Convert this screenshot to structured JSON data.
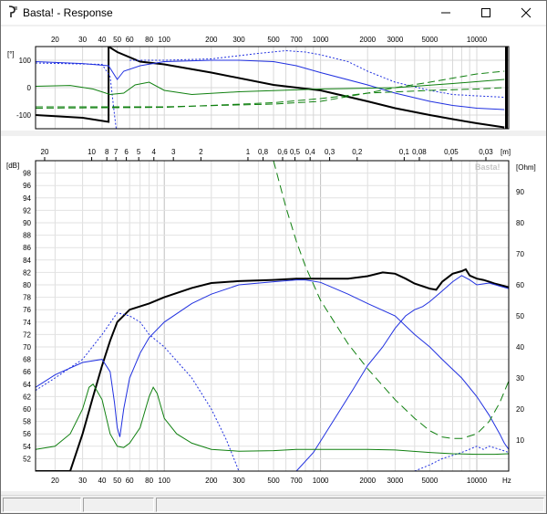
{
  "window": {
    "title": "Basta! - Response",
    "icon": "basta-app-icon",
    "controls": [
      "minimize-icon",
      "maximize-icon",
      "close-icon"
    ]
  },
  "phase_chart": {
    "y_unit": "[°]",
    "y_ticks": [
      "100",
      "0",
      "-100"
    ],
    "x_ticks": [
      "20",
      "30",
      "40",
      "50",
      "60",
      "80",
      "100",
      "200",
      "300",
      "500",
      "700",
      "1000",
      "2000",
      "3000",
      "5000",
      "10000"
    ]
  },
  "main_chart": {
    "watermark": "Basta!",
    "left_unit": "[dB]",
    "right_unit": "[Ohm]",
    "top_unit": "[m]",
    "bottom_unit": "Hz",
    "spl_ticks": [
      "98",
      "96",
      "94",
      "92",
      "90",
      "88",
      "86",
      "84",
      "82",
      "80",
      "78",
      "76",
      "74",
      "72",
      "70",
      "68",
      "66",
      "64",
      "62",
      "60",
      "58",
      "56",
      "54",
      "52"
    ],
    "ohm_ticks": [
      "90",
      "80",
      "70",
      "60",
      "50",
      "40",
      "30",
      "20",
      "10"
    ],
    "wavelength_ticks": [
      "30",
      "20",
      "10",
      "8",
      "7",
      "6",
      "5",
      "4",
      "3",
      "2",
      "1",
      "0,8",
      "0,6",
      "0,5",
      "0,4",
      "0,3",
      "0,2",
      "0,1",
      "0,08",
      "0,05",
      "0,03"
    ],
    "freq_ticks": [
      "20",
      "30",
      "40",
      "50",
      "60",
      "80",
      "100",
      "200",
      "300",
      "500",
      "700",
      "1000",
      "2000",
      "3000",
      "5000",
      "10000"
    ]
  },
  "chart_data": {
    "type": "line",
    "x_scale": "log",
    "xlim": [
      15,
      16000
    ],
    "ylim": [
      50,
      100
    ],
    "y2lim": [
      0,
      100
    ],
    "xlabel": "Hz",
    "ylabel": "[dB]",
    "y2label": "[Ohm]",
    "grid": true,
    "series": [
      {
        "axis": "spl",
        "color": "#000000",
        "style": "solid",
        "width": 2,
        "points": [
          [
            15,
            50
          ],
          [
            25,
            50
          ],
          [
            30,
            56
          ],
          [
            35,
            62
          ],
          [
            40,
            67
          ],
          [
            45,
            71
          ],
          [
            50,
            74
          ],
          [
            60,
            76
          ],
          [
            80,
            77
          ],
          [
            100,
            78
          ],
          [
            150,
            79.5
          ],
          [
            200,
            80.3
          ],
          [
            300,
            80.6
          ],
          [
            500,
            80.8
          ],
          [
            700,
            81
          ],
          [
            1000,
            81
          ],
          [
            1500,
            81
          ],
          [
            2000,
            81.4
          ],
          [
            2500,
            82
          ],
          [
            3000,
            81.8
          ],
          [
            3500,
            81
          ],
          [
            4000,
            80.2
          ],
          [
            5000,
            79.4
          ],
          [
            5500,
            79.2
          ],
          [
            6000,
            80.5
          ],
          [
            7000,
            81.8
          ],
          [
            8000,
            82.2
          ],
          [
            8500,
            82.5
          ],
          [
            9000,
            81.5
          ],
          [
            10000,
            81
          ],
          [
            11000,
            80.8
          ],
          [
            12000,
            80.5
          ],
          [
            13000,
            80.2
          ],
          [
            14000,
            80
          ],
          [
            15000,
            79.8
          ],
          [
            16000,
            79.6
          ]
        ]
      },
      {
        "axis": "spl",
        "color": "#2030e0",
        "style": "solid",
        "width": 1,
        "points": [
          [
            15,
            63.5
          ],
          [
            20,
            65.5
          ],
          [
            30,
            67.5
          ],
          [
            40,
            68
          ],
          [
            45,
            66
          ],
          [
            48,
            61
          ],
          [
            50,
            57
          ],
          [
            52,
            55.5
          ],
          [
            55,
            60
          ],
          [
            60,
            65
          ],
          [
            70,
            69
          ],
          [
            80,
            71.5
          ],
          [
            100,
            74
          ],
          [
            150,
            77
          ],
          [
            200,
            78.5
          ],
          [
            300,
            80
          ],
          [
            500,
            80.5
          ],
          [
            700,
            80.8
          ],
          [
            800,
            80.8
          ],
          [
            1000,
            80.4
          ],
          [
            1500,
            78.5
          ],
          [
            2000,
            77
          ],
          [
            3000,
            75
          ],
          [
            4000,
            72
          ],
          [
            5000,
            70
          ],
          [
            6000,
            68
          ],
          [
            8000,
            65
          ],
          [
            10000,
            62
          ],
          [
            12000,
            59
          ],
          [
            14000,
            56
          ],
          [
            15000,
            54.5
          ],
          [
            16000,
            53.5
          ]
        ]
      },
      {
        "axis": "spl",
        "color": "#2030e0",
        "style": "solid",
        "width": 1,
        "points": [
          [
            700,
            50
          ],
          [
            900,
            53
          ],
          [
            1200,
            58
          ],
          [
            1600,
            63
          ],
          [
            2000,
            67
          ],
          [
            2500,
            70
          ],
          [
            3000,
            73
          ],
          [
            3500,
            75
          ],
          [
            4000,
            76
          ],
          [
            4500,
            76.5
          ],
          [
            5000,
            77.3
          ],
          [
            6000,
            79
          ],
          [
            7000,
            80.5
          ],
          [
            8000,
            81.5
          ],
          [
            9000,
            80.8
          ],
          [
            10000,
            80
          ],
          [
            12000,
            80.3
          ],
          [
            14000,
            79.8
          ],
          [
            16000,
            79.4
          ]
        ]
      },
      {
        "axis": "spl",
        "color": "#2030e0",
        "style": "dash",
        "width": 1,
        "points": [
          [
            15,
            63
          ],
          [
            20,
            65
          ],
          [
            30,
            68
          ],
          [
            40,
            72
          ],
          [
            50,
            75.5
          ],
          [
            60,
            75
          ],
          [
            70,
            74
          ],
          [
            80,
            72
          ],
          [
            100,
            70
          ],
          [
            150,
            65
          ],
          [
            200,
            60
          ],
          [
            250,
            55
          ],
          [
            300,
            50
          ]
        ]
      },
      {
        "axis": "spl",
        "color": "#2030e0",
        "style": "dash",
        "width": 1,
        "points": [
          [
            4000,
            50
          ],
          [
            5000,
            51
          ],
          [
            6000,
            52
          ],
          [
            8000,
            53
          ],
          [
            10000,
            54
          ],
          [
            11000,
            53.5
          ],
          [
            12000,
            54
          ],
          [
            14000,
            53.5
          ],
          [
            16000,
            53
          ]
        ]
      },
      {
        "axis": "spl",
        "color": "#108010",
        "style": "solid",
        "width": 1,
        "points": [
          [
            15,
            53.5
          ],
          [
            20,
            54
          ],
          [
            25,
            56
          ],
          [
            30,
            60
          ],
          [
            33,
            63.5
          ],
          [
            35,
            64
          ],
          [
            40,
            61.5
          ],
          [
            45,
            56
          ],
          [
            50,
            54
          ],
          [
            55,
            53.8
          ],
          [
            60,
            54.5
          ],
          [
            70,
            57
          ],
          [
            80,
            62
          ],
          [
            85,
            63.5
          ],
          [
            90,
            62.5
          ],
          [
            100,
            58.5
          ],
          [
            120,
            56
          ],
          [
            150,
            54.5
          ],
          [
            200,
            53.5
          ],
          [
            300,
            53.2
          ],
          [
            500,
            53.3
          ],
          [
            700,
            53.5
          ],
          [
            1000,
            53.5
          ],
          [
            1500,
            53.5
          ],
          [
            2000,
            53.5
          ],
          [
            3000,
            53.4
          ],
          [
            5000,
            53
          ],
          [
            7000,
            52.8
          ],
          [
            10000,
            52.7
          ],
          [
            13000,
            52.7
          ],
          [
            16000,
            52.8
          ]
        ]
      },
      {
        "axis": "ohm",
        "color": "#108010",
        "style": "dash",
        "width": 1,
        "points": [
          [
            500,
            100
          ],
          [
            600,
            85
          ],
          [
            700,
            74
          ],
          [
            800,
            66
          ],
          [
            1000,
            55
          ],
          [
            1500,
            41
          ],
          [
            2000,
            33
          ],
          [
            3000,
            23
          ],
          [
            4000,
            17
          ],
          [
            5000,
            13
          ],
          [
            6000,
            11
          ],
          [
            7000,
            10.5
          ],
          [
            8000,
            10.5
          ],
          [
            10000,
            12
          ],
          [
            12000,
            16
          ],
          [
            14000,
            22
          ],
          [
            16000,
            29
          ]
        ]
      }
    ],
    "phase_series": [
      {
        "color": "#000000",
        "style": "solid",
        "width": 2,
        "points": [
          [
            15,
            -100
          ],
          [
            30,
            -110
          ],
          [
            44,
            -125
          ],
          [
            44,
            150
          ],
          [
            50,
            130
          ],
          [
            70,
            95
          ],
          [
            100,
            85
          ],
          [
            200,
            55
          ],
          [
            500,
            10
          ],
          [
            1000,
            -10
          ],
          [
            2000,
            -50
          ],
          [
            3000,
            -75
          ],
          [
            5000,
            -100
          ],
          [
            7000,
            -115
          ],
          [
            10000,
            -130
          ],
          [
            15000,
            -145
          ]
        ]
      },
      {
        "color": "#2030e0",
        "style": "solid",
        "width": 1,
        "points": [
          [
            15,
            95
          ],
          [
            30,
            88
          ],
          [
            44,
            80
          ],
          [
            50,
            30
          ],
          [
            55,
            60
          ],
          [
            70,
            80
          ],
          [
            100,
            95
          ],
          [
            200,
            100
          ],
          [
            300,
            100
          ],
          [
            500,
            95
          ],
          [
            700,
            80
          ],
          [
            1000,
            55
          ],
          [
            2000,
            10
          ],
          [
            3000,
            -20
          ],
          [
            5000,
            -50
          ],
          [
            7000,
            -65
          ],
          [
            10000,
            -75
          ],
          [
            15000,
            -80
          ]
        ]
      },
      {
        "color": "#2030e0",
        "style": "dash",
        "width": 1,
        "points": [
          [
            15,
            90
          ],
          [
            40,
            85
          ],
          [
            45,
            40
          ],
          [
            48,
            -100
          ],
          [
            50,
            -180
          ]
        ]
      },
      {
        "color": "#2030e0",
        "style": "dash",
        "width": 1,
        "points": [
          [
            60,
            100
          ],
          [
            100,
            100
          ],
          [
            200,
            105
          ],
          [
            400,
            125
          ],
          [
            600,
            135
          ],
          [
            800,
            130
          ],
          [
            1000,
            120
          ],
          [
            1500,
            95
          ],
          [
            2000,
            60
          ],
          [
            3000,
            20
          ],
          [
            5000,
            -10
          ],
          [
            7000,
            -25
          ],
          [
            10000,
            -30
          ],
          [
            15000,
            -35
          ]
        ]
      },
      {
        "color": "#108010",
        "style": "solid",
        "width": 1,
        "points": [
          [
            15,
            5
          ],
          [
            25,
            8
          ],
          [
            35,
            -5
          ],
          [
            45,
            -25
          ],
          [
            55,
            -20
          ],
          [
            65,
            10
          ],
          [
            80,
            20
          ],
          [
            100,
            -10
          ],
          [
            150,
            -25
          ],
          [
            300,
            -15
          ],
          [
            1000,
            -5
          ],
          [
            3000,
            0
          ],
          [
            7000,
            15
          ],
          [
            15000,
            30
          ]
        ]
      },
      {
        "color": "#108010",
        "style": "dash",
        "width": 1,
        "points": [
          [
            15,
            -70
          ],
          [
            100,
            -70
          ],
          [
            500,
            -60
          ],
          [
            1000,
            -50
          ],
          [
            2000,
            -20
          ],
          [
            3000,
            0
          ],
          [
            5000,
            20
          ],
          [
            10000,
            50
          ],
          [
            15000,
            60
          ]
        ]
      },
      {
        "color": "#108010",
        "style": "dash",
        "width": 1,
        "points": [
          [
            15,
            -75
          ],
          [
            100,
            -72
          ],
          [
            500,
            -55
          ],
          [
            1000,
            -40
          ],
          [
            2000,
            -20
          ],
          [
            5000,
            -10
          ],
          [
            10000,
            -5
          ],
          [
            15000,
            0
          ]
        ]
      }
    ]
  },
  "statusbar": {
    "cells": [
      "",
      "",
      ""
    ]
  }
}
